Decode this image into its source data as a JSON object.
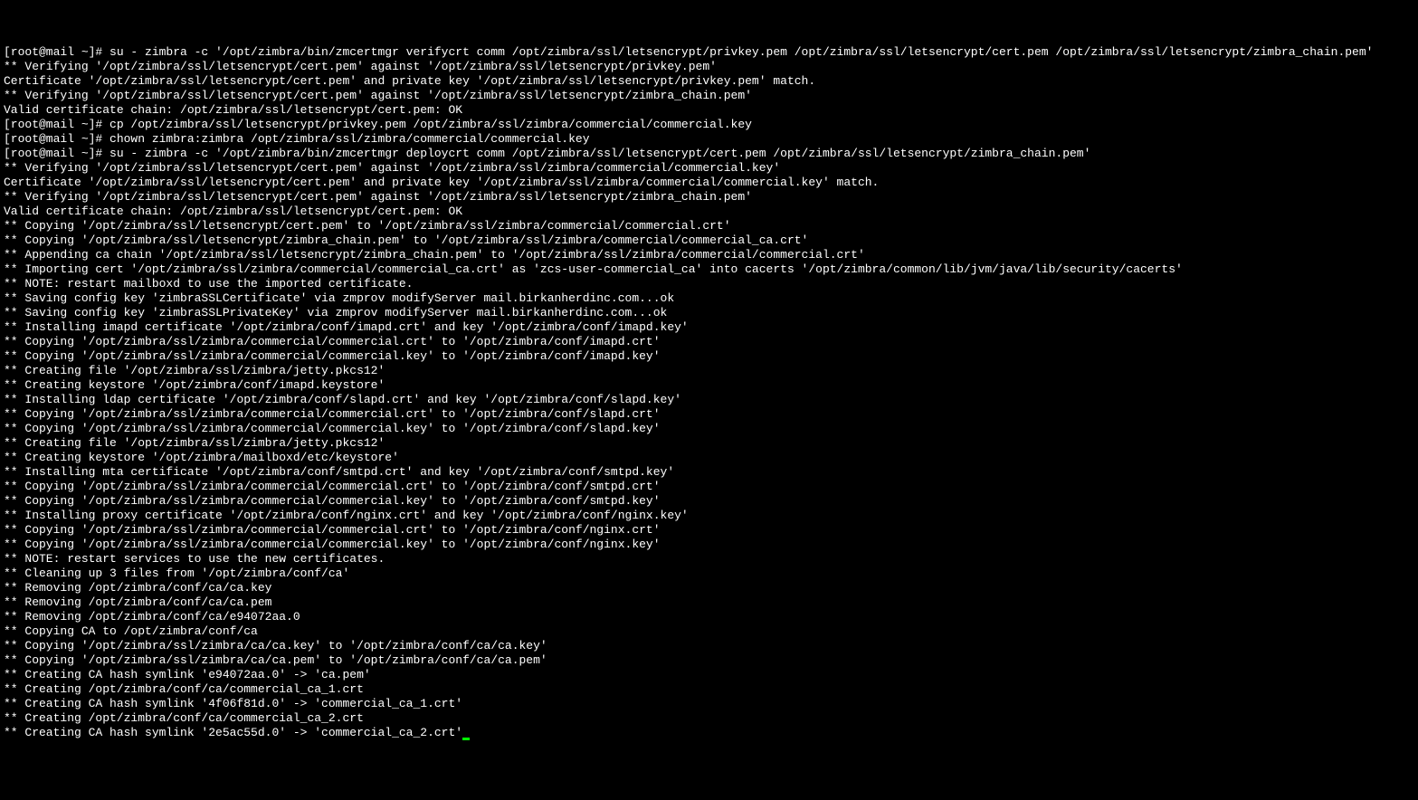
{
  "terminal": {
    "lines": [
      "[root@mail ~]# su - zimbra -c '/opt/zimbra/bin/zmcertmgr verifycrt comm /opt/zimbra/ssl/letsencrypt/privkey.pem /opt/zimbra/ssl/letsencrypt/cert.pem /opt/zimbra/ssl/letsencrypt/zimbra_chain.pem'",
      "** Verifying '/opt/zimbra/ssl/letsencrypt/cert.pem' against '/opt/zimbra/ssl/letsencrypt/privkey.pem'",
      "Certificate '/opt/zimbra/ssl/letsencrypt/cert.pem' and private key '/opt/zimbra/ssl/letsencrypt/privkey.pem' match.",
      "** Verifying '/opt/zimbra/ssl/letsencrypt/cert.pem' against '/opt/zimbra/ssl/letsencrypt/zimbra_chain.pem'",
      "Valid certificate chain: /opt/zimbra/ssl/letsencrypt/cert.pem: OK",
      "[root@mail ~]# cp /opt/zimbra/ssl/letsencrypt/privkey.pem /opt/zimbra/ssl/zimbra/commercial/commercial.key",
      "[root@mail ~]# chown zimbra:zimbra /opt/zimbra/ssl/zimbra/commercial/commercial.key",
      "[root@mail ~]# su - zimbra -c '/opt/zimbra/bin/zmcertmgr deploycrt comm /opt/zimbra/ssl/letsencrypt/cert.pem /opt/zimbra/ssl/letsencrypt/zimbra_chain.pem'",
      "** Verifying '/opt/zimbra/ssl/letsencrypt/cert.pem' against '/opt/zimbra/ssl/zimbra/commercial/commercial.key'",
      "Certificate '/opt/zimbra/ssl/letsencrypt/cert.pem' and private key '/opt/zimbra/ssl/zimbra/commercial/commercial.key' match.",
      "** Verifying '/opt/zimbra/ssl/letsencrypt/cert.pem' against '/opt/zimbra/ssl/letsencrypt/zimbra_chain.pem'",
      "Valid certificate chain: /opt/zimbra/ssl/letsencrypt/cert.pem: OK",
      "** Copying '/opt/zimbra/ssl/letsencrypt/cert.pem' to '/opt/zimbra/ssl/zimbra/commercial/commercial.crt'",
      "** Copying '/opt/zimbra/ssl/letsencrypt/zimbra_chain.pem' to '/opt/zimbra/ssl/zimbra/commercial/commercial_ca.crt'",
      "** Appending ca chain '/opt/zimbra/ssl/letsencrypt/zimbra_chain.pem' to '/opt/zimbra/ssl/zimbra/commercial/commercial.crt'",
      "** Importing cert '/opt/zimbra/ssl/zimbra/commercial/commercial_ca.crt' as 'zcs-user-commercial_ca' into cacerts '/opt/zimbra/common/lib/jvm/java/lib/security/cacerts'",
      "** NOTE: restart mailboxd to use the imported certificate.",
      "** Saving config key 'zimbraSSLCertificate' via zmprov modifyServer mail.birkanherdinc.com...ok",
      "** Saving config key 'zimbraSSLPrivateKey' via zmprov modifyServer mail.birkanherdinc.com...ok",
      "** Installing imapd certificate '/opt/zimbra/conf/imapd.crt' and key '/opt/zimbra/conf/imapd.key'",
      "** Copying '/opt/zimbra/ssl/zimbra/commercial/commercial.crt' to '/opt/zimbra/conf/imapd.crt'",
      "** Copying '/opt/zimbra/ssl/zimbra/commercial/commercial.key' to '/opt/zimbra/conf/imapd.key'",
      "** Creating file '/opt/zimbra/ssl/zimbra/jetty.pkcs12'",
      "** Creating keystore '/opt/zimbra/conf/imapd.keystore'",
      "** Installing ldap certificate '/opt/zimbra/conf/slapd.crt' and key '/opt/zimbra/conf/slapd.key'",
      "** Copying '/opt/zimbra/ssl/zimbra/commercial/commercial.crt' to '/opt/zimbra/conf/slapd.crt'",
      "** Copying '/opt/zimbra/ssl/zimbra/commercial/commercial.key' to '/opt/zimbra/conf/slapd.key'",
      "** Creating file '/opt/zimbra/ssl/zimbra/jetty.pkcs12'",
      "** Creating keystore '/opt/zimbra/mailboxd/etc/keystore'",
      "** Installing mta certificate '/opt/zimbra/conf/smtpd.crt' and key '/opt/zimbra/conf/smtpd.key'",
      "** Copying '/opt/zimbra/ssl/zimbra/commercial/commercial.crt' to '/opt/zimbra/conf/smtpd.crt'",
      "** Copying '/opt/zimbra/ssl/zimbra/commercial/commercial.key' to '/opt/zimbra/conf/smtpd.key'",
      "** Installing proxy certificate '/opt/zimbra/conf/nginx.crt' and key '/opt/zimbra/conf/nginx.key'",
      "** Copying '/opt/zimbra/ssl/zimbra/commercial/commercial.crt' to '/opt/zimbra/conf/nginx.crt'",
      "** Copying '/opt/zimbra/ssl/zimbra/commercial/commercial.key' to '/opt/zimbra/conf/nginx.key'",
      "** NOTE: restart services to use the new certificates.",
      "** Cleaning up 3 files from '/opt/zimbra/conf/ca'",
      "** Removing /opt/zimbra/conf/ca/ca.key",
      "** Removing /opt/zimbra/conf/ca/ca.pem",
      "** Removing /opt/zimbra/conf/ca/e94072aa.0",
      "** Copying CA to /opt/zimbra/conf/ca",
      "** Copying '/opt/zimbra/ssl/zimbra/ca/ca.key' to '/opt/zimbra/conf/ca/ca.key'",
      "** Copying '/opt/zimbra/ssl/zimbra/ca/ca.pem' to '/opt/zimbra/conf/ca/ca.pem'",
      "** Creating CA hash symlink 'e94072aa.0' -> 'ca.pem'",
      "** Creating /opt/zimbra/conf/ca/commercial_ca_1.crt",
      "** Creating CA hash symlink '4f06f81d.0' -> 'commercial_ca_1.crt'",
      "** Creating /opt/zimbra/conf/ca/commercial_ca_2.crt",
      "** Creating CA hash symlink '2e5ac55d.0' -> 'commercial_ca_2.crt'"
    ]
  }
}
